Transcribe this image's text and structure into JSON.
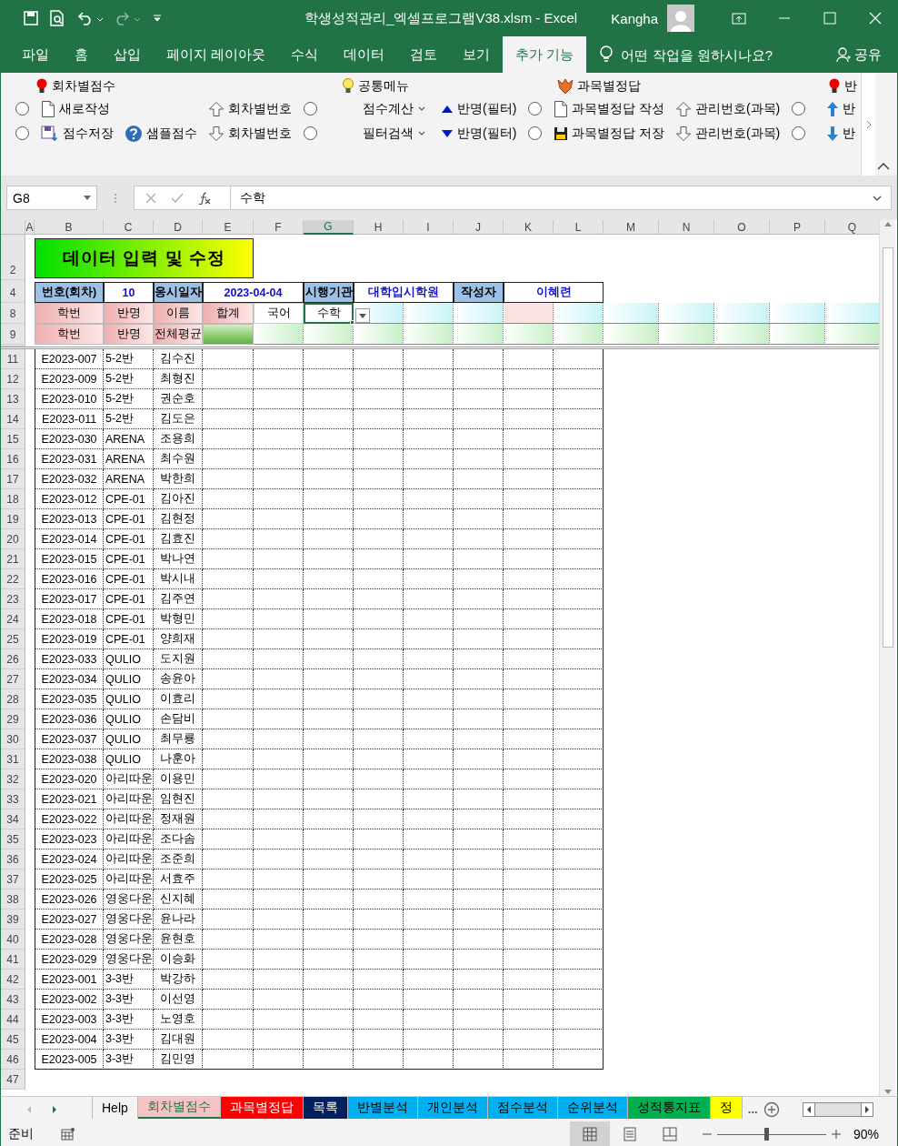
{
  "window": {
    "title": "학생성적관리_엑셀프로그램V38.xlsm  -  Excel",
    "user": "Kangha"
  },
  "menu_tabs": [
    {
      "label": "파일",
      "selected": false
    },
    {
      "label": "홈",
      "selected": false
    },
    {
      "label": "삽입",
      "selected": false
    },
    {
      "label": "페이지 레이아웃",
      "selected": false
    },
    {
      "label": "수식",
      "selected": false
    },
    {
      "label": "데이터",
      "selected": false
    },
    {
      "label": "검토",
      "selected": false
    },
    {
      "label": "보기",
      "selected": false
    },
    {
      "label": "추가 기능",
      "selected": true
    }
  ],
  "tell_me": {
    "placeholder": "어떤 작업을 원하시나요?"
  },
  "share": {
    "label": "공유"
  },
  "ribbon": {
    "groups": [
      {
        "label": "회차별점수",
        "columns": [
          {
            "items": [
              {
                "kind": "radio",
                "selected": false
              },
              {
                "kind": "radio",
                "selected": false
              }
            ]
          },
          {
            "items": [
              {
                "kind": "button",
                "label": "새로작성"
              },
              {
                "kind": "button",
                "label": "점수저장"
              }
            ]
          },
          {
            "items": [
              {
                "kind": "button",
                "label": "샘플점수"
              }
            ]
          },
          {
            "items": [
              {
                "kind": "button",
                "label": "회차별번호"
              },
              {
                "kind": "button",
                "label": "회차별번호"
              }
            ]
          },
          {
            "items": [
              {
                "kind": "radio",
                "selected": false
              },
              {
                "kind": "radio",
                "selected": false
              }
            ]
          }
        ]
      },
      {
        "label": "공통메뉴",
        "columns": [
          {
            "items": [
              {
                "kind": "dropdown",
                "label": "점수계산"
              },
              {
                "kind": "dropdown",
                "label": "필터검색"
              }
            ]
          },
          {
            "items": [
              {
                "kind": "button",
                "label": "반명(필터)"
              },
              {
                "kind": "button",
                "label": "반명(필터)"
              }
            ]
          },
          {
            "items": [
              {
                "kind": "radio",
                "selected": false
              },
              {
                "kind": "radio",
                "selected": false
              }
            ]
          }
        ]
      },
      {
        "label": "과목별정답",
        "columns": [
          {
            "items": [
              {
                "kind": "button",
                "label": "과목별정답 작성"
              },
              {
                "kind": "button",
                "label": "과목별정답 저장"
              }
            ]
          },
          {
            "items": [
              {
                "kind": "button",
                "label": "관리번호(과목)"
              },
              {
                "kind": "button",
                "label": "관리번호(과목)"
              }
            ]
          },
          {
            "items": [
              {
                "kind": "radio",
                "selected": false
              },
              {
                "kind": "radio",
                "selected": false
              }
            ]
          }
        ]
      },
      {
        "label": "반",
        "columns": [
          {
            "items": [
              {
                "kind": "button",
                "label": "반"
              },
              {
                "kind": "button",
                "label": "반"
              }
            ]
          }
        ]
      }
    ]
  },
  "formula_bar": {
    "name_box": "G8",
    "formula": "수학"
  },
  "sheet": {
    "columns": [
      {
        "label": "A",
        "selected": false
      },
      {
        "label": "B",
        "selected": false
      },
      {
        "label": "C",
        "selected": false
      },
      {
        "label": "D",
        "selected": false
      },
      {
        "label": "E",
        "selected": false
      },
      {
        "label": "F",
        "selected": false
      },
      {
        "label": "G",
        "selected": true
      },
      {
        "label": "H",
        "selected": false
      },
      {
        "label": "I",
        "selected": false
      },
      {
        "label": "J",
        "selected": false
      },
      {
        "label": "K",
        "selected": false
      },
      {
        "label": "L",
        "selected": false
      },
      {
        "label": "M",
        "selected": false
      },
      {
        "label": "N",
        "selected": false
      },
      {
        "label": "O",
        "selected": false
      },
      {
        "label": "P",
        "selected": false
      },
      {
        "label": "Q",
        "selected": false
      }
    ],
    "header_rows": [
      {
        "row": "2",
        "kind": "title",
        "cells": [
          {
            "text": "데이터 입력 및 수정",
            "kind": "title"
          }
        ]
      },
      {
        "row": "4",
        "kind": "info",
        "cells": [
          {
            "text": "번호(회차)",
            "kind": "field-label"
          },
          {
            "text": "10",
            "kind": "field-value"
          },
          {
            "text": "응시일자",
            "kind": "field-label"
          },
          {
            "text": "2023-04-04",
            "kind": "field-value"
          },
          {
            "text": "시행기관",
            "kind": "field-label"
          },
          {
            "text": "대학입시학원",
            "kind": "field-value"
          },
          {
            "text": "작성자",
            "kind": "field-label"
          },
          {
            "text": "이혜련",
            "kind": "field-value"
          }
        ]
      },
      {
        "row": "8",
        "kind": "header",
        "cells": [
          {
            "text": "학번",
            "kind": "column-label"
          },
          {
            "text": "반명",
            "kind": "column-label"
          },
          {
            "text": "이름",
            "kind": "column-label"
          },
          {
            "text": "합계",
            "kind": "column-label"
          },
          {
            "text": "국어",
            "kind": "subject",
            "selected": false
          },
          {
            "text": "수학",
            "kind": "subject",
            "selected": true
          },
          {
            "kind": "entry"
          },
          {
            "kind": "entry"
          },
          {
            "kind": "entry"
          },
          {
            "kind": "entry-alt"
          },
          {
            "kind": "entry"
          },
          {
            "kind": "entry"
          },
          {
            "kind": "entry"
          },
          {
            "kind": "entry"
          },
          {
            "kind": "entry"
          },
          {
            "kind": "entry"
          }
        ]
      },
      {
        "row": "9",
        "kind": "header",
        "cells": [
          {
            "text": "학번",
            "kind": "column-label"
          },
          {
            "text": "반명",
            "kind": "column-label"
          },
          {
            "text": "전체평균",
            "kind": "column-label"
          },
          {
            "kind": "sum-entry"
          },
          {
            "kind": "avg-entry"
          },
          {
            "kind": "avg-entry"
          },
          {
            "kind": "avg-entry"
          },
          {
            "kind": "avg-entry"
          },
          {
            "kind": "avg-entry"
          },
          {
            "kind": "avg-entry"
          },
          {
            "kind": "avg-entry"
          },
          {
            "kind": "avg-entry"
          },
          {
            "kind": "avg-entry"
          },
          {
            "kind": "avg-entry"
          },
          {
            "kind": "avg-entry"
          },
          {
            "kind": "avg-entry"
          }
        ]
      }
    ],
    "rows": [
      {
        "row": "11",
        "student_id": "E2023-007",
        "class": "5-2반",
        "name": "김수진"
      },
      {
        "row": "12",
        "student_id": "E2023-009",
        "class": "5-2반",
        "name": "최형진"
      },
      {
        "row": "13",
        "student_id": "E2023-010",
        "class": "5-2반",
        "name": "권순호"
      },
      {
        "row": "14",
        "student_id": "E2023-011",
        "class": "5-2반",
        "name": "김도은"
      },
      {
        "row": "15",
        "student_id": "E2023-030",
        "class": "ARENA",
        "name": "조용희"
      },
      {
        "row": "16",
        "student_id": "E2023-031",
        "class": "ARENA",
        "name": "최수원"
      },
      {
        "row": "17",
        "student_id": "E2023-032",
        "class": "ARENA",
        "name": "박한희"
      },
      {
        "row": "18",
        "student_id": "E2023-012",
        "class": "CPE-01",
        "name": "김아진"
      },
      {
        "row": "19",
        "student_id": "E2023-013",
        "class": "CPE-01",
        "name": "김현정"
      },
      {
        "row": "20",
        "student_id": "E2023-014",
        "class": "CPE-01",
        "name": "김효진"
      },
      {
        "row": "21",
        "student_id": "E2023-015",
        "class": "CPE-01",
        "name": "박나연"
      },
      {
        "row": "22",
        "student_id": "E2023-016",
        "class": "CPE-01",
        "name": "박시내"
      },
      {
        "row": "23",
        "student_id": "E2023-017",
        "class": "CPE-01",
        "name": "김주연"
      },
      {
        "row": "24",
        "student_id": "E2023-018",
        "class": "CPE-01",
        "name": "박형민"
      },
      {
        "row": "25",
        "student_id": "E2023-019",
        "class": "CPE-01",
        "name": "양희재"
      },
      {
        "row": "26",
        "student_id": "E2023-033",
        "class": "QULIO",
        "name": "도지원"
      },
      {
        "row": "27",
        "student_id": "E2023-034",
        "class": "QULIO",
        "name": "송윤아"
      },
      {
        "row": "28",
        "student_id": "E2023-035",
        "class": "QULIO",
        "name": "이효리"
      },
      {
        "row": "29",
        "student_id": "E2023-036",
        "class": "QULIO",
        "name": "손담비"
      },
      {
        "row": "30",
        "student_id": "E2023-037",
        "class": "QULIO",
        "name": "최무룡"
      },
      {
        "row": "31",
        "student_id": "E2023-038",
        "class": "QULIO",
        "name": "나훈아"
      },
      {
        "row": "32",
        "student_id": "E2023-020",
        "class": "아리따운",
        "name": "이용민"
      },
      {
        "row": "33",
        "student_id": "E2023-021",
        "class": "아리따운",
        "name": "임현진"
      },
      {
        "row": "34",
        "student_id": "E2023-022",
        "class": "아리따운",
        "name": "정재원"
      },
      {
        "row": "35",
        "student_id": "E2023-023",
        "class": "아리따운",
        "name": "조다솜"
      },
      {
        "row": "36",
        "student_id": "E2023-024",
        "class": "아리따운",
        "name": "조준희"
      },
      {
        "row": "37",
        "student_id": "E2023-025",
        "class": "아리따운",
        "name": "서효주"
      },
      {
        "row": "38",
        "student_id": "E2023-026",
        "class": "영웅다운",
        "name": "신지혜"
      },
      {
        "row": "39",
        "student_id": "E2023-027",
        "class": "영웅다운",
        "name": "윤나라"
      },
      {
        "row": "40",
        "student_id": "E2023-028",
        "class": "영웅다운",
        "name": "윤현호"
      },
      {
        "row": "41",
        "student_id": "E2023-029",
        "class": "영웅다운",
        "name": "이승화"
      },
      {
        "row": "42",
        "student_id": "E2023-001",
        "class": "3-3반",
        "name": "박강하"
      },
      {
        "row": "43",
        "student_id": "E2023-002",
        "class": "3-3반",
        "name": "이선영"
      },
      {
        "row": "44",
        "student_id": "E2023-003",
        "class": "3-3반",
        "name": "노영호"
      },
      {
        "row": "45",
        "student_id": "E2023-004",
        "class": "3-3반",
        "name": "김대원"
      },
      {
        "row": "46",
        "student_id": "E2023-005",
        "class": "3-3반",
        "name": "김민영"
      }
    ],
    "empty_rows": [
      "47"
    ]
  },
  "sheet_tabs": [
    {
      "label": "Help",
      "selected": false
    },
    {
      "label": "회차별점수",
      "selected": true,
      "color": "#f4c4c4"
    },
    {
      "label": "과목별정답",
      "selected": false,
      "color": "#ff0000"
    },
    {
      "label": "목록",
      "selected": false,
      "color": "#002060"
    },
    {
      "label": "반별분석",
      "selected": false,
      "color": "#00b0f0"
    },
    {
      "label": "개인분석",
      "selected": false,
      "color": "#00b0f0"
    },
    {
      "label": "점수분석",
      "selected": false,
      "color": "#00b0f0"
    },
    {
      "label": "순위분석",
      "selected": false,
      "color": "#00b0f0"
    },
    {
      "label": "성적통지표",
      "selected": false,
      "color": "#00b050"
    },
    {
      "label": "정",
      "selected": false,
      "color": "#ffff00"
    }
  ],
  "more_tabs": "...",
  "status_bar": {
    "status": "준비",
    "zoom": "90%",
    "zoom_level": {
      "level": 0.45
    }
  }
}
